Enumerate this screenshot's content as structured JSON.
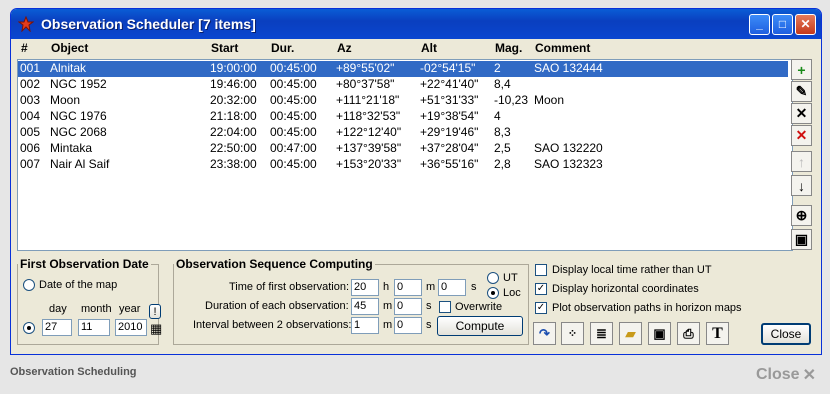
{
  "window": {
    "title": "Observation Scheduler [7 items]"
  },
  "columns": [
    "#",
    "Object",
    "Start",
    "Dur.",
    "Az",
    "Alt",
    "Mag.",
    "Comment"
  ],
  "rows": [
    {
      "num": "001",
      "object": "Alnitak",
      "start": "19:00:00",
      "dur": "00:45:00",
      "az": "+89°55'02\"",
      "alt": "-02°54'15\"",
      "mag": "2",
      "comment": "SAO 132444",
      "selected": true
    },
    {
      "num": "002",
      "object": "NGC 1952",
      "start": "19:46:00",
      "dur": "00:45:00",
      "az": "+80°37'58\"",
      "alt": "+22°41'40\"",
      "mag": "8,4",
      "comment": ""
    },
    {
      "num": "003",
      "object": "Moon",
      "start": "20:32:00",
      "dur": "00:45:00",
      "az": "+111°21'18\"",
      "alt": "+51°31'33\"",
      "mag": "-10,23",
      "comment": "Moon"
    },
    {
      "num": "004",
      "object": "NGC 1976",
      "start": "21:18:00",
      "dur": "00:45:00",
      "az": "+118°32'53\"",
      "alt": "+19°38'54\"",
      "mag": "4",
      "comment": ""
    },
    {
      "num": "005",
      "object": "NGC 2068",
      "start": "22:04:00",
      "dur": "00:45:00",
      "az": "+122°12'40\"",
      "alt": "+29°19'46\"",
      "mag": "8,3",
      "comment": ""
    },
    {
      "num": "006",
      "object": "Mintaka",
      "start": "22:50:00",
      "dur": "00:47:00",
      "az": "+137°39'58\"",
      "alt": "+37°28'04\"",
      "mag": "2,5",
      "comment": "SAO 132220"
    },
    {
      "num": "007",
      "object": "Nair Al Saif",
      "start": "23:38:00",
      "dur": "00:45:00",
      "az": "+153°20'33\"",
      "alt": "+36°55'16\"",
      "mag": "2,8",
      "comment": "SAO 132323"
    }
  ],
  "first_date": {
    "legend": "First Observation Date",
    "opt_map": "Date of the map",
    "day_label": "day",
    "month_label": "month",
    "year_label": "year",
    "day": "27",
    "month": "11",
    "year": "2010",
    "bang": "!"
  },
  "sequence": {
    "legend": "Observation Sequence Computing",
    "time_label": "Time of first observation:",
    "duration_label": "Duration of each observation:",
    "interval_label": "Interval between 2 observations:",
    "time_h": "20",
    "time_m": "0",
    "time_s": "0",
    "dur_m": "45",
    "dur_s": "0",
    "int_m": "1",
    "int_s": "0",
    "h": "h",
    "m": "m",
    "s": "s",
    "ut": "UT",
    "loc": "Loc",
    "overwrite": "Overwrite",
    "compute": "Compute"
  },
  "options": {
    "local_time": "Display local time rather than UT",
    "horizontal": "Display horizontal coordinates",
    "paths": "Plot observation paths in horizon maps"
  },
  "buttons": {
    "close": "Close",
    "text_tool": "T"
  },
  "footer": {
    "label": "Observation Scheduling",
    "close": "Close"
  }
}
